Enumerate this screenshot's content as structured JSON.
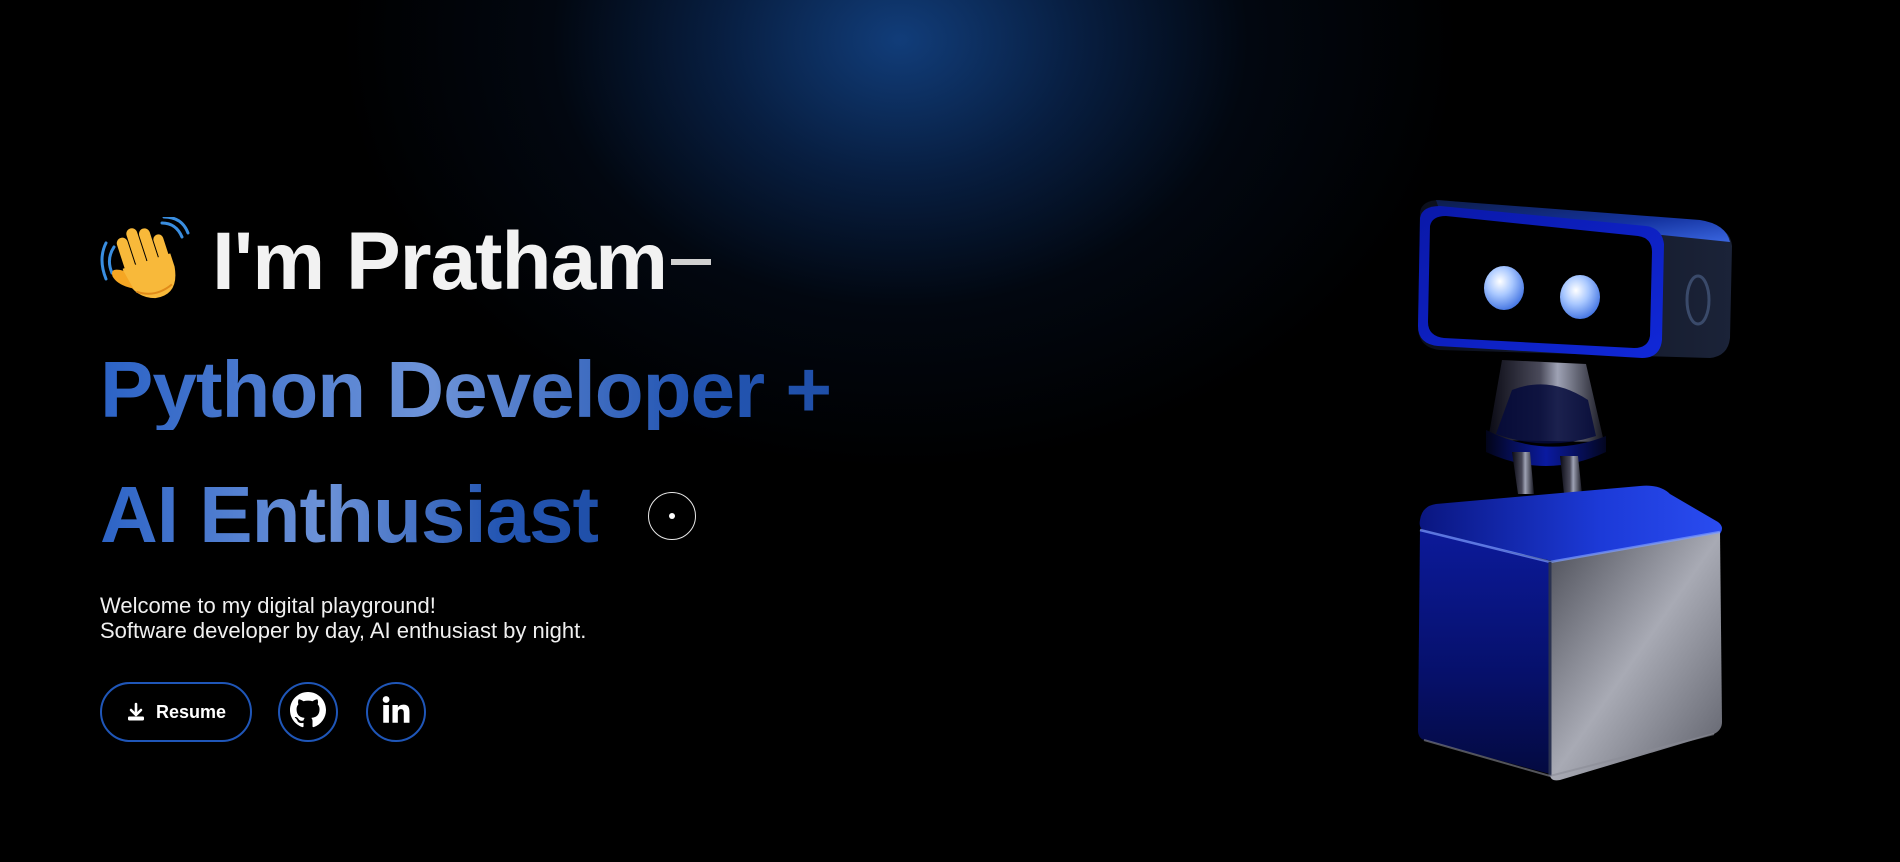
{
  "hero": {
    "greeting": "I'm Pratham",
    "greeting_icon": "waving-hand-icon",
    "role_line_1": "Python Developer +",
    "role_line_2": "AI Enthusiast",
    "intro_line_1": "Welcome to my digital playground!",
    "intro_line_2": "Software developer by day, AI enthusiast by night."
  },
  "actions": {
    "resume_label": "Resume",
    "resume_icon": "download-icon",
    "github_icon": "github-icon",
    "linkedin_icon": "linkedin-icon"
  },
  "colors": {
    "background": "#000000",
    "accent": "#1f56b8",
    "heading_gradient_start": "#2c63c6",
    "heading_gradient_mid": "#6d93d8",
    "text": "#f2f2f2"
  },
  "illustration": {
    "icon": "robot-icon"
  }
}
